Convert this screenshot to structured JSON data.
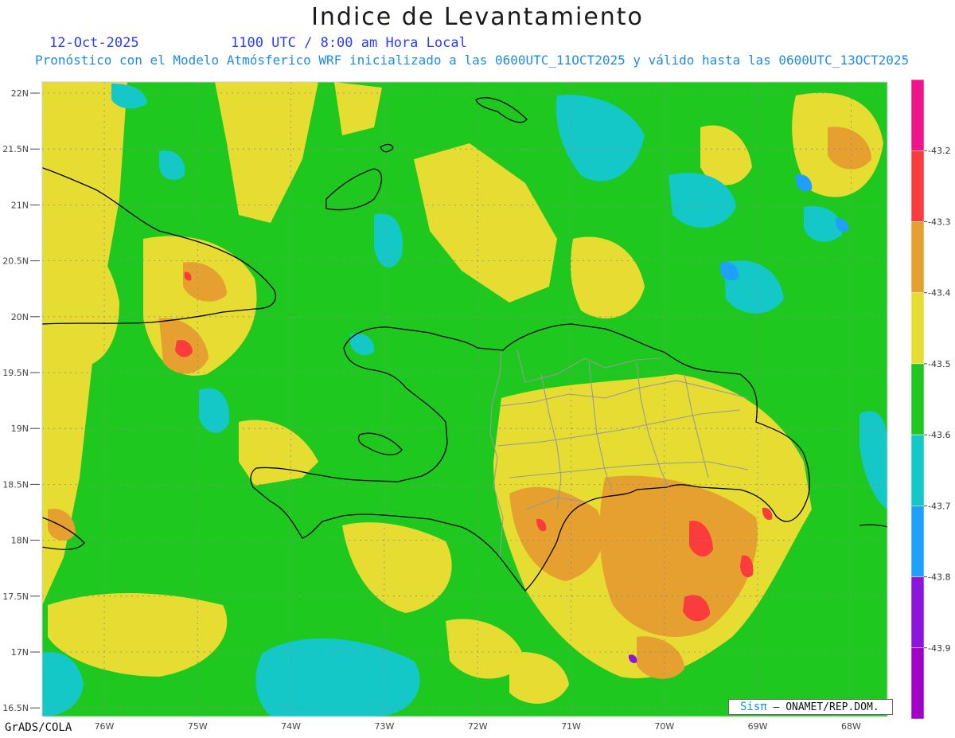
{
  "title": "Indice de Levantamiento",
  "date": "12-Oct-2025",
  "time": "1100 UTC / 8:00 am Hora Local",
  "forecast_note": "Pronóstico con el Modelo Atmósferico WRF inicializado a las 0600UTC_11OCT2025 y válido hasta las  0600UTC_13OCT2025",
  "credit": "GrADS/COLA",
  "logo": {
    "brand": "Sisπ",
    "agency": "– ONAMET/REP.DOM."
  },
  "lat_labels": [
    "22N",
    "21.5N",
    "21N",
    "20.5N",
    "20N",
    "19.5N",
    "19N",
    "18.5N",
    "18N",
    "17.5N",
    "17N",
    "16.5N"
  ],
  "lon_labels": [
    "76W",
    "75W",
    "74W",
    "73W",
    "72W",
    "71W",
    "70W",
    "69W",
    "68W"
  ],
  "colorbar": {
    "labels": [
      "-43.2",
      "-43.3",
      "-43.4",
      "-43.5",
      "-43.6",
      "-43.7",
      "-43.8",
      "-43.9"
    ],
    "colors": [
      "#f0148c",
      "#fa3c3c",
      "#e6a030",
      "#e6dc32",
      "#1ec81e",
      "#14c8c8",
      "#1ea0ff",
      "#8c14dc",
      "#a000c8"
    ]
  },
  "palette": {
    "green": "#1ec81e",
    "yellow": "#e6dc32",
    "orange": "#e6a030",
    "red": "#fa3c3c",
    "cyan": "#14c8c8",
    "blue": "#1ea0ff",
    "purple": "#8c14dc"
  },
  "icons": {
    "coastline": "coastline-outline",
    "borders": "province-border-lines"
  }
}
